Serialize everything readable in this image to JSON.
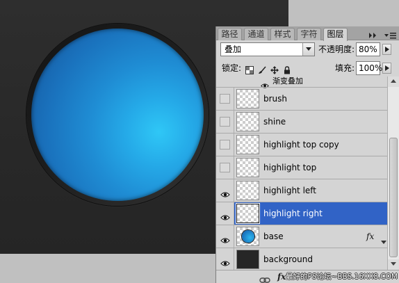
{
  "panel": {
    "tabs": [
      {
        "label": "路径"
      },
      {
        "label": "通道"
      },
      {
        "label": "样式"
      },
      {
        "label": "字符"
      },
      {
        "label": "图层",
        "active": true
      }
    ],
    "blend_mode": "叠加",
    "opacity_label": "不透明度:",
    "opacity_value": "80%",
    "lock_label": "锁定:",
    "fill_label": "填充:",
    "fill_value": "100%",
    "effect_row": {
      "label": "渐变叠加",
      "visible": true
    },
    "layers": [
      {
        "name": "brush",
        "visible": false,
        "thumbnail": "transparent"
      },
      {
        "name": "shine",
        "visible": false,
        "thumbnail": "transparent"
      },
      {
        "name": "highlight top copy",
        "visible": false,
        "thumbnail": "transparent"
      },
      {
        "name": "highlight top",
        "visible": false,
        "thumbnail": "transparent"
      },
      {
        "name": "highlight left",
        "visible": true,
        "thumbnail": "transparent"
      },
      {
        "name": "highlight right",
        "visible": true,
        "thumbnail": "transparent",
        "selected": true
      },
      {
        "name": "base",
        "visible": true,
        "thumbnail": "blue-circle",
        "fx": "fx"
      },
      {
        "name": "background",
        "visible": true,
        "thumbnail": "dark"
      }
    ],
    "footer": {
      "fx_label": "fx"
    }
  },
  "watermark": "最好的PS论坛~BBS.16XX8.COM",
  "colors": {
    "selected_layer": "#3163c6"
  }
}
